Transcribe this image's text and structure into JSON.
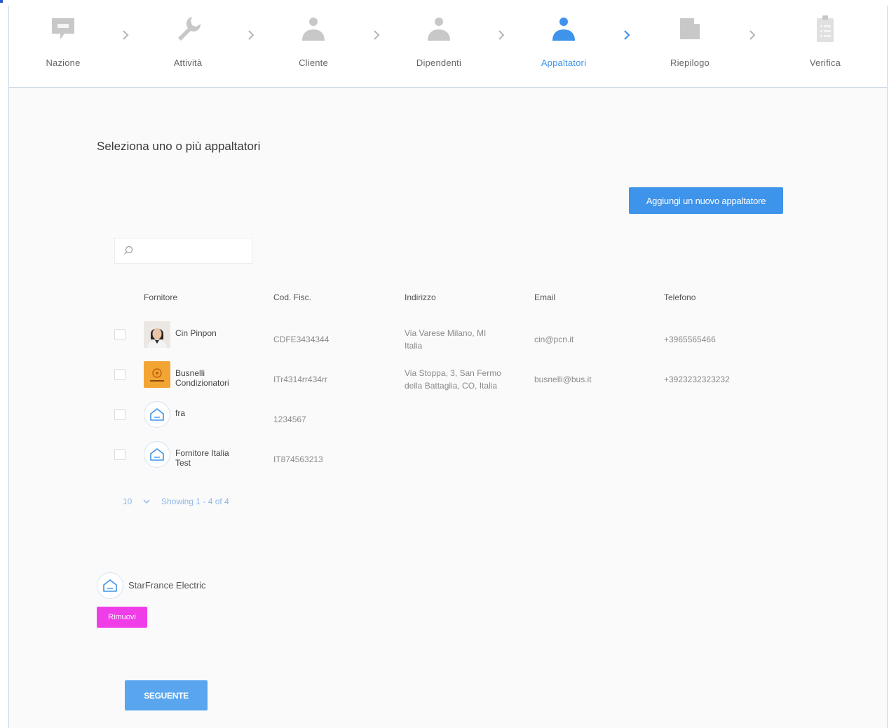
{
  "stepper": {
    "steps": [
      {
        "label": "Nazione",
        "icon": "flag-icon",
        "active": false
      },
      {
        "label": "Attività",
        "icon": "wrench-icon",
        "active": false
      },
      {
        "label": "Cliente",
        "icon": "person-icon",
        "active": false
      },
      {
        "label": "Dipendenti",
        "icon": "person-icon",
        "active": false
      },
      {
        "label": "Appaltatori",
        "icon": "person-icon",
        "active": true
      },
      {
        "label": "Riepilogo",
        "icon": "document-icon",
        "active": false
      },
      {
        "label": "Verifica",
        "icon": "clipboard-icon",
        "active": false
      }
    ]
  },
  "colors": {
    "accent": "#3e93ea",
    "icon_inactive": "#c5c5c5",
    "remove": "#ef3ee8",
    "next": "#59a6ee"
  },
  "main": {
    "title": "Seleziona uno o più appaltatori",
    "add_button": "Aggiungi un nuovo appaltatore",
    "search": {
      "placeholder": "",
      "value": ""
    }
  },
  "table": {
    "headers": [
      "Fornitore",
      "Cod. Fisc.",
      "Indirizzo",
      "Email",
      "Telefono"
    ],
    "rows": [
      {
        "name": [
          "Cin Pinpon"
        ],
        "avatar": "photo",
        "cf": "CDFE3434344",
        "address": [
          "Via Varese Milano, MI",
          "Italia"
        ],
        "email": "cin@pcn.it",
        "phone": "+3965565466"
      },
      {
        "name": [
          "Busnelli",
          "Condizionatori"
        ],
        "avatar": "logo",
        "cf": "ITr4314rr434rr",
        "address": [
          "Via Stoppa, 3, San Fermo",
          "della Battaglia, CO, Italia"
        ],
        "email": "busnelli@bus.it",
        "phone": "+3923232323232"
      },
      {
        "name": [
          "fra"
        ],
        "avatar": "house",
        "cf": "1234567",
        "address": [],
        "email": "",
        "phone": ""
      },
      {
        "name": [
          "Fornitore Italia",
          "Test"
        ],
        "avatar": "house",
        "cf": "IT874563213",
        "address": [],
        "email": "",
        "phone": ""
      }
    ]
  },
  "pagination": {
    "page_size": "10",
    "info": "Showing 1 - 4 of 4"
  },
  "selected": {
    "name": "StarFrance Electric",
    "remove_label": "Rimuovi"
  },
  "footer": {
    "next_label": "SEGUENTE"
  }
}
